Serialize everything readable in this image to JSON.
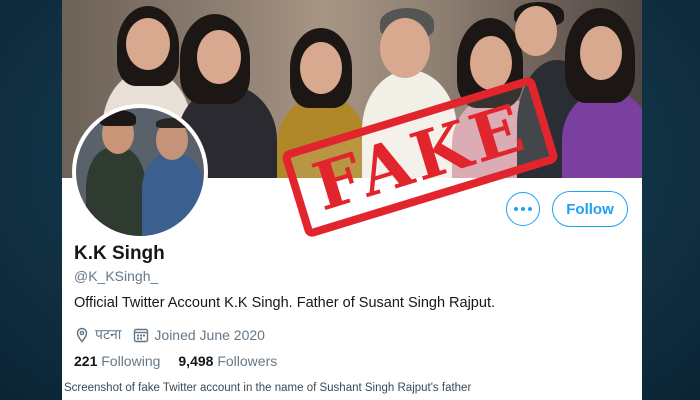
{
  "profile": {
    "name": "K.K Singh",
    "handle": "@K_KSingh_",
    "bio": "Official Twitter Account K.K Singh. Father of Susant Singh Rajput.",
    "location": "पटना",
    "joined": "Joined June 2020",
    "following_count": "221",
    "following_label": "Following",
    "followers_count": "9,498",
    "followers_label": "Followers"
  },
  "actions": {
    "follow_label": "Follow"
  },
  "overlay": {
    "stamp_text": "FAKE",
    "stamp_color": "#e2242c"
  },
  "caption": "Screenshot of fake Twitter account in the name of Sushant Singh Rajput's father",
  "colors": {
    "accent": "#1da1f2",
    "background": "#123447"
  },
  "icons": {
    "location": "location-pin-icon",
    "calendar": "calendar-icon",
    "more": "more-options-icon"
  }
}
